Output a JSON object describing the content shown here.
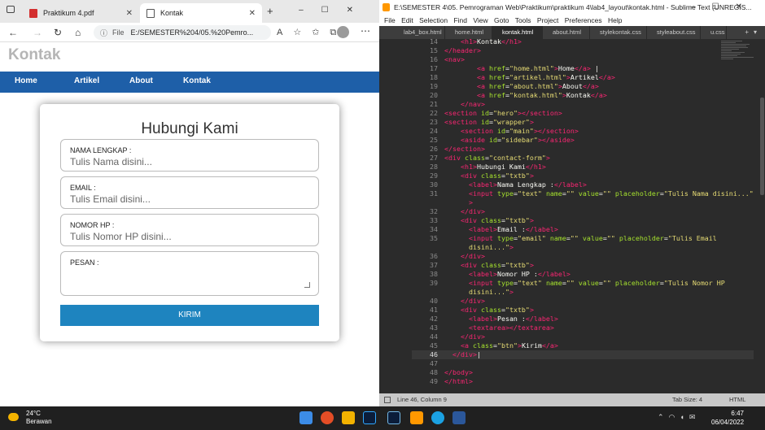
{
  "browser": {
    "tabs": [
      {
        "label": "Praktikum 4.pdf"
      },
      {
        "label": "Kontak"
      }
    ],
    "address": {
      "prefix": "File",
      "url": "E:/SEMESTER%204/05.%20Pemro..."
    },
    "site": {
      "title": "Kontak",
      "nav": [
        "Home",
        "Artikel",
        "About",
        "Kontak"
      ],
      "form": {
        "heading": "Hubungi Kami",
        "fields": [
          {
            "label": "NAMA LENGKAP :",
            "placeholder": "Tulis Nama disini..."
          },
          {
            "label": "EMAIL :",
            "placeholder": "Tulis Email disini..."
          },
          {
            "label": "NOMOR HP :",
            "placeholder": "Tulis Nomor HP disini..."
          },
          {
            "label": "PESAN :",
            "placeholder": ""
          }
        ],
        "button": "KIRIM"
      }
    }
  },
  "sublime": {
    "title": "E:\\SEMESTER 4\\05. Pemrograman Web\\Praktikum\\praktikum 4\\lab4_layout\\kontak.html - Sublime Text (UNREGIS...",
    "menu": [
      "File",
      "Edit",
      "Selection",
      "Find",
      "View",
      "Goto",
      "Tools",
      "Project",
      "Preferences",
      "Help"
    ],
    "tabs": [
      "lab4_box.html",
      "home.html",
      "kontak.html",
      "about.html",
      "stylekontak.css",
      "styleabout.css",
      "u.css"
    ],
    "active_tab": "kontak.html",
    "status": {
      "position": "Line 46, Column 9",
      "tab_size": "Tab Size: 4",
      "syntax": "HTML"
    }
  },
  "taskbar": {
    "weather_temp": "24°C",
    "weather_desc": "Berawan",
    "time": "6:47",
    "date": "06/04/2022"
  },
  "colors": {
    "nav_blue": "#1e5fa8",
    "button_blue": "#1e84bf",
    "editor_bg": "#2b2b2b"
  }
}
